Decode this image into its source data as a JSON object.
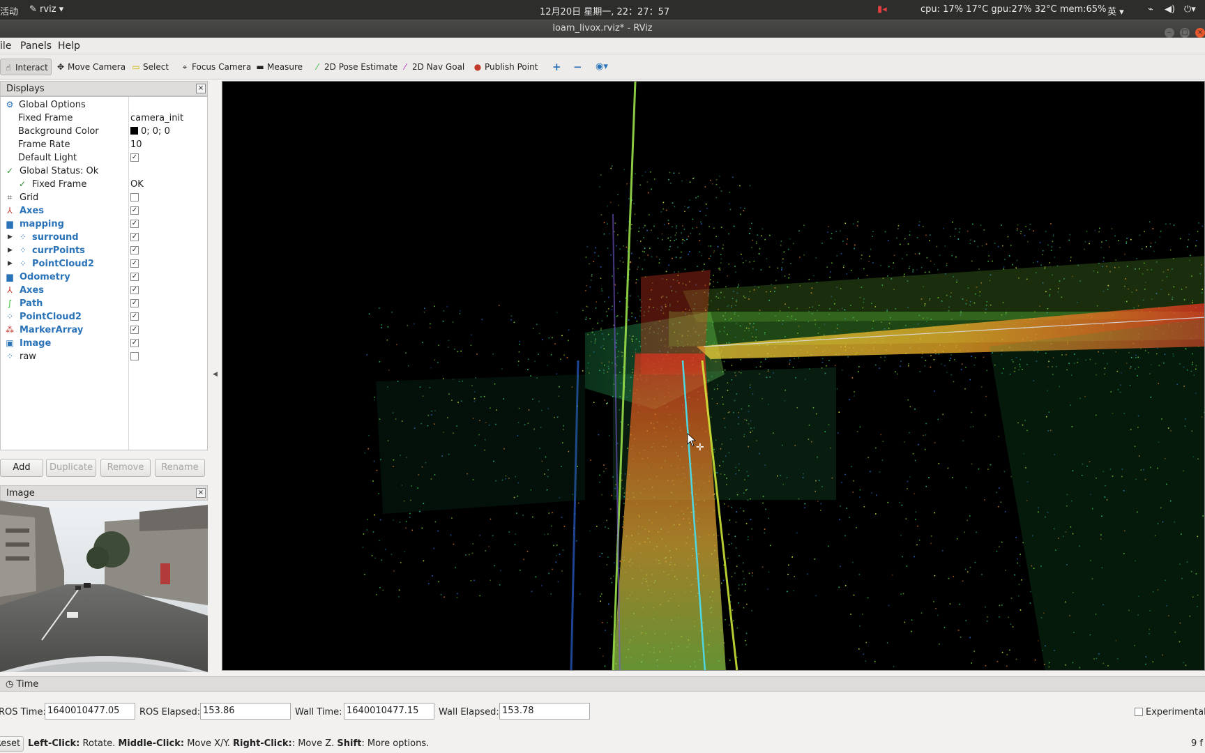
{
  "system_bar": {
    "activities": "活动",
    "app_menu": "rviz",
    "clock": "12月20日 星期一, 22：27：57",
    "stats": "cpu: 17% 17°C gpu:27% 32°C mem:65%",
    "ime": "英"
  },
  "window": {
    "title": "loam_livox.rviz* - RViz"
  },
  "menu": {
    "file": "File",
    "panels": "Panels",
    "help": "Help"
  },
  "toolbar": {
    "interact": "Interact",
    "move_camera": "Move Camera",
    "select": "Select",
    "focus_camera": "Focus Camera",
    "measure": "Measure",
    "pose_estimate": "2D Pose Estimate",
    "nav_goal": "2D Nav Goal",
    "publish_point": "Publish Point",
    "colors": {
      "pose": "#2dbb2d",
      "nav": "#b52bb5",
      "point": "#c0392b",
      "blue": "#2a73b8"
    }
  },
  "displays": {
    "title": "Displays",
    "global_options": "Global Options",
    "fixed_frame_label": "Fixed Frame",
    "fixed_frame_value": "camera_init",
    "bg_label": "Background Color",
    "bg_value": "0; 0; 0",
    "frame_rate_label": "Frame Rate",
    "frame_rate_value": "10",
    "default_light_label": "Default Light",
    "global_status": "Global Status: Ok",
    "status_fixed_frame": "Fixed Frame",
    "status_ok": "OK",
    "grid": "Grid",
    "axes": "Axes",
    "mapping": "mapping",
    "surround": "surround",
    "curr_points": "currPoints",
    "pointcloud2": "PointCloud2",
    "odometry": "Odometry",
    "axes2": "Axes",
    "path": "Path",
    "pointcloud2_b": "PointCloud2",
    "marker_array": "MarkerArray",
    "image": "Image",
    "raw": "raw"
  },
  "panel_buttons": {
    "add": "Add",
    "duplicate": "Duplicate",
    "remove": "Remove",
    "rename": "Rename"
  },
  "image_panel": {
    "title": "Image"
  },
  "time_panel": {
    "title": "Time",
    "ros_time_label": "ROS Time:",
    "ros_time": "1640010477.05",
    "ros_elapsed_label": "ROS Elapsed:",
    "ros_elapsed": "153.86",
    "wall_time_label": "Wall Time:",
    "wall_time": "1640010477.15",
    "wall_elapsed_label": "Wall Elapsed:",
    "wall_elapsed": "153.78",
    "experimental": "Experimental"
  },
  "status": {
    "reset": "Reset",
    "left_click": "Left-Click:",
    "left_action": "Rotate.",
    "middle_click": "Middle-Click:",
    "middle_action": "Move X/Y.",
    "right_click": "Right-Click:",
    "right_action": "Move Z.",
    "shift": "Shift",
    "shift_action": ": More options.",
    "fps": "9 f"
  }
}
